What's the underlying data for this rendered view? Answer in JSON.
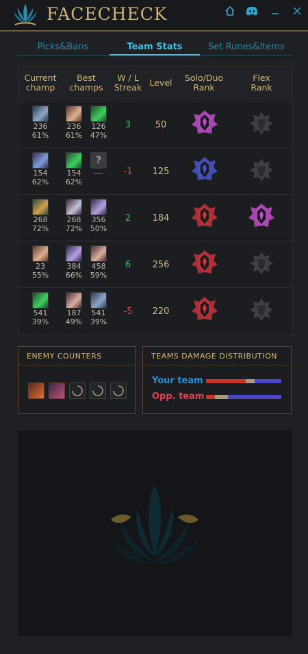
{
  "app": {
    "title": "FACECHECK"
  },
  "tabs": [
    {
      "label": "Picks&Bans",
      "active": false
    },
    {
      "label": "Team Stats",
      "active": true
    },
    {
      "label": "Set Runes&Items",
      "active": false
    }
  ],
  "headers": {
    "current": [
      "Current",
      "champ"
    ],
    "best": [
      "Best",
      "champs"
    ],
    "streak": [
      "W / L",
      "Streak"
    ],
    "level": "Level",
    "solo": [
      "Solo/Duo",
      "Rank"
    ],
    "flex": [
      "Flex",
      "Rank"
    ]
  },
  "rows": [
    {
      "current": {
        "games": "236",
        "wr": "61%",
        "icon": "champ-icon"
      },
      "best": [
        {
          "games": "236",
          "wr": "61%",
          "icon": "champ-icon"
        },
        {
          "games": "126",
          "wr": "47%",
          "icon": "champ-icon"
        }
      ],
      "streak": "3",
      "streak_type": "win",
      "level": "50",
      "solo": "master",
      "flex": "unranked"
    },
    {
      "current": {
        "games": "154",
        "wr": "62%",
        "icon": "champ-icon"
      },
      "best": [
        {
          "games": "154",
          "wr": "62%",
          "icon": "champ-icon"
        },
        {
          "games": "---",
          "wr": "",
          "icon": "unknown",
          "glyph": "?"
        }
      ],
      "streak": "-1",
      "streak_type": "loss",
      "level": "125",
      "solo": "diamond",
      "flex": "unranked"
    },
    {
      "current": {
        "games": "268",
        "wr": "72%",
        "icon": "champ-icon"
      },
      "best": [
        {
          "games": "268",
          "wr": "72%",
          "icon": "champ-icon"
        },
        {
          "games": "356",
          "wr": "50%",
          "icon": "champ-icon"
        }
      ],
      "streak": "2",
      "streak_type": "win",
      "level": "184",
      "solo": "grandmaster",
      "flex": "master"
    },
    {
      "current": {
        "games": "23",
        "wr": "55%",
        "icon": "champ-icon"
      },
      "best": [
        {
          "games": "384",
          "wr": "66%",
          "icon": "champ-icon"
        },
        {
          "games": "458",
          "wr": "59%",
          "icon": "champ-icon"
        }
      ],
      "streak": "6",
      "streak_type": "win",
      "level": "256",
      "solo": "grandmaster",
      "flex": "unranked"
    },
    {
      "current": {
        "games": "541",
        "wr": "39%",
        "icon": "champ-icon"
      },
      "best": [
        {
          "games": "187",
          "wr": "49%",
          "icon": "champ-icon"
        },
        {
          "games": "541",
          "wr": "39%",
          "icon": "champ-icon"
        }
      ],
      "streak": "-5",
      "streak_type": "loss",
      "level": "220",
      "solo": "grandmaster",
      "flex": "unranked"
    }
  ],
  "enemy_counters": {
    "title": "ENEMY COUNTERS",
    "count_champs": 2,
    "count_loading": 3
  },
  "damage": {
    "title": "TEAMS DAMAGE DISTRIBUTION",
    "your_team": {
      "label": "Your team",
      "physical": 0.53,
      "true": 0.12,
      "magic": 0.35
    },
    "opp_team": {
      "label": "Opp. team",
      "physical": 0.12,
      "true": 0.17,
      "magic": 0.71
    }
  },
  "colors": {
    "accent": "#3fc1e5",
    "gold": "#d6b66a",
    "win": "#3bbf62",
    "loss": "#e0433e",
    "your_team": "#2e8fd8",
    "opp_team": "#e0434f",
    "physical": "#c7352d",
    "true": "#a89a7c",
    "magic": "#4a47c9",
    "master": "#c04dc9",
    "diamond": "#4a58c8",
    "grandmaster": "#c8343c",
    "unranked": "#3d3f44"
  }
}
